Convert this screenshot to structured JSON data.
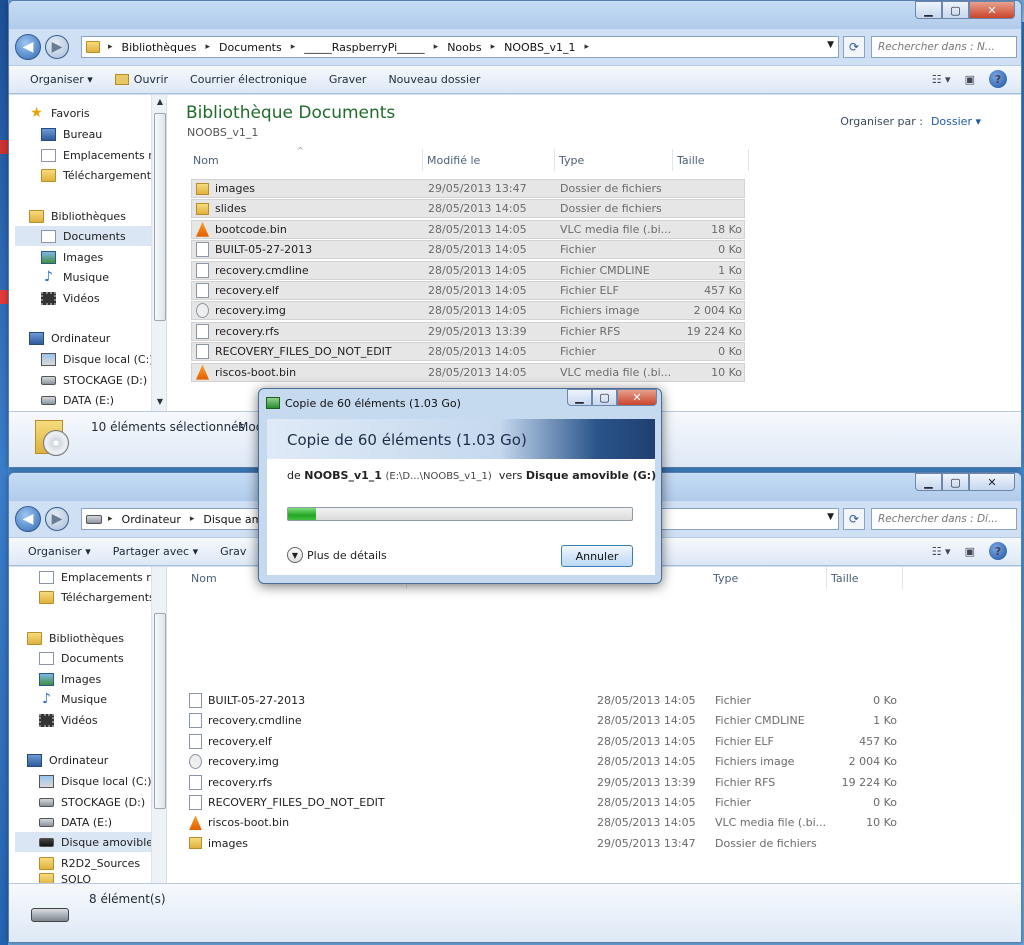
{
  "top_window": {
    "breadcrumb": [
      "Bibliothèques",
      "Documents",
      "_____RaspberryPi_____",
      "Noobs",
      "NOOBS_v1_1"
    ],
    "search_placeholder": "Rechercher dans : N...",
    "toolbar": {
      "organize": "Organiser",
      "open": "Ouvrir",
      "email": "Courrier électronique",
      "burn": "Graver",
      "new_folder": "Nouveau dossier"
    },
    "nav": {
      "favorites": "Favoris",
      "desktop": "Bureau",
      "recent": "Emplacements ré",
      "downloads": "Téléchargements",
      "libraries": "Bibliothèques",
      "documents": "Documents",
      "images": "Images",
      "music": "Musique",
      "videos": "Vidéos",
      "computer": "Ordinateur",
      "local_disk": "Disque local (C:)",
      "storage": "STOCKAGE (D:)",
      "data": "DATA (E:)"
    },
    "library_title": "Bibliothèque Documents",
    "library_subtitle": "NOOBS_v1_1",
    "organize_by_label": "Organiser par :",
    "organize_by_value": "Dossier",
    "columns": {
      "name": "Nom",
      "modified": "Modifié le",
      "type": "Type",
      "size": "Taille"
    },
    "files": [
      {
        "name": "images",
        "date": "29/05/2013 13:47",
        "type": "Dossier de fichiers",
        "size": "",
        "icon": "folder-icon"
      },
      {
        "name": "slides",
        "date": "28/05/2013 14:05",
        "type": "Dossier de fichiers",
        "size": "",
        "icon": "folder-icon"
      },
      {
        "name": "bootcode.bin",
        "date": "28/05/2013 14:05",
        "type": "VLC media file (.bi...",
        "size": "18 Ko",
        "icon": "vlc-icon"
      },
      {
        "name": "BUILT-05-27-2013",
        "date": "28/05/2013 14:05",
        "type": "Fichier",
        "size": "0 Ko",
        "icon": "file-icon"
      },
      {
        "name": "recovery.cmdline",
        "date": "28/05/2013 14:05",
        "type": "Fichier CMDLINE",
        "size": "1 Ko",
        "icon": "file-icon"
      },
      {
        "name": "recovery.elf",
        "date": "28/05/2013 14:05",
        "type": "Fichier ELF",
        "size": "457 Ko",
        "icon": "file-icon"
      },
      {
        "name": "recovery.img",
        "date": "28/05/2013 14:05",
        "type": "Fichiers image",
        "size": "2 004 Ko",
        "icon": "disc-image-icon"
      },
      {
        "name": "recovery.rfs",
        "date": "29/05/2013 13:39",
        "type": "Fichier RFS",
        "size": "19 224 Ko",
        "icon": "file-icon"
      },
      {
        "name": "RECOVERY_FILES_DO_NOT_EDIT",
        "date": "28/05/2013 14:05",
        "type": "Fichier",
        "size": "0 Ko",
        "icon": "file-icon"
      },
      {
        "name": "riscos-boot.bin",
        "date": "28/05/2013 14:05",
        "type": "VLC media file (.bi...",
        "size": "10 Ko",
        "icon": "vlc-icon"
      }
    ],
    "status_text": "10 éléments sélectionnés",
    "status_extra": "Mod"
  },
  "bottom_window": {
    "breadcrumb": [
      "Ordinateur",
      "Disque amov"
    ],
    "search_placeholder": "Rechercher dans : Di...",
    "toolbar": {
      "organize": "Organiser",
      "share": "Partager avec",
      "burn": "Grav"
    },
    "nav": {
      "recent": "Emplacements ré",
      "downloads": "Téléchargements",
      "libraries": "Bibliothèques",
      "documents": "Documents",
      "images": "Images",
      "music": "Musique",
      "videos": "Vidéos",
      "computer": "Ordinateur",
      "local_disk": "Disque local (C:)",
      "storage": "STOCKAGE (D:)",
      "data": "DATA (E:)",
      "removable": "Disque amovible",
      "r2d2": "R2D2_Sources",
      "solo": "SOLO"
    },
    "columns": {
      "name": "Nom",
      "type": "Type",
      "size": "Taille"
    },
    "files": [
      {
        "name": "BUILT-05-27-2013",
        "date": "28/05/2013 14:05",
        "type": "Fichier",
        "size": "0 Ko",
        "icon": "file-icon"
      },
      {
        "name": "recovery.cmdline",
        "date": "28/05/2013 14:05",
        "type": "Fichier CMDLINE",
        "size": "1 Ko",
        "icon": "file-icon"
      },
      {
        "name": "recovery.elf",
        "date": "28/05/2013 14:05",
        "type": "Fichier ELF",
        "size": "457 Ko",
        "icon": "file-icon"
      },
      {
        "name": "recovery.img",
        "date": "28/05/2013 14:05",
        "type": "Fichiers image",
        "size": "2 004 Ko",
        "icon": "disc-image-icon"
      },
      {
        "name": "recovery.rfs",
        "date": "29/05/2013 13:39",
        "type": "Fichier RFS",
        "size": "19 224 Ko",
        "icon": "file-icon"
      },
      {
        "name": "RECOVERY_FILES_DO_NOT_EDIT",
        "date": "28/05/2013 14:05",
        "type": "Fichier",
        "size": "0 Ko",
        "icon": "file-icon"
      },
      {
        "name": "riscos-boot.bin",
        "date": "28/05/2013 14:05",
        "type": "VLC media file (.bi...",
        "size": "10 Ko",
        "icon": "vlc-icon"
      },
      {
        "name": "images",
        "date": "29/05/2013 13:47",
        "type": "Dossier de fichiers",
        "size": "",
        "icon": "folder-icon"
      }
    ],
    "status_text": "8 élément(s)"
  },
  "copy_dialog": {
    "title": "Copie de 60 éléments (1.03 Go)",
    "heading": "Copie de 60 éléments (1.03 Go)",
    "from_prefix": "de",
    "from_name": "NOOBS_v1_1",
    "from_path": "(E:\\D...\\NOOBS_v1_1)",
    "to_prefix": "vers",
    "to_name": "Disque amovible (G:)",
    "progress_fraction": 0.08,
    "more_details": "Plus de détails",
    "cancel": "Annuler"
  },
  "colors": {
    "accent_green": "#1f6c2a",
    "progress_green": "#24a624",
    "link_blue": "#1e5aa8",
    "close_red": "#c9452c"
  }
}
